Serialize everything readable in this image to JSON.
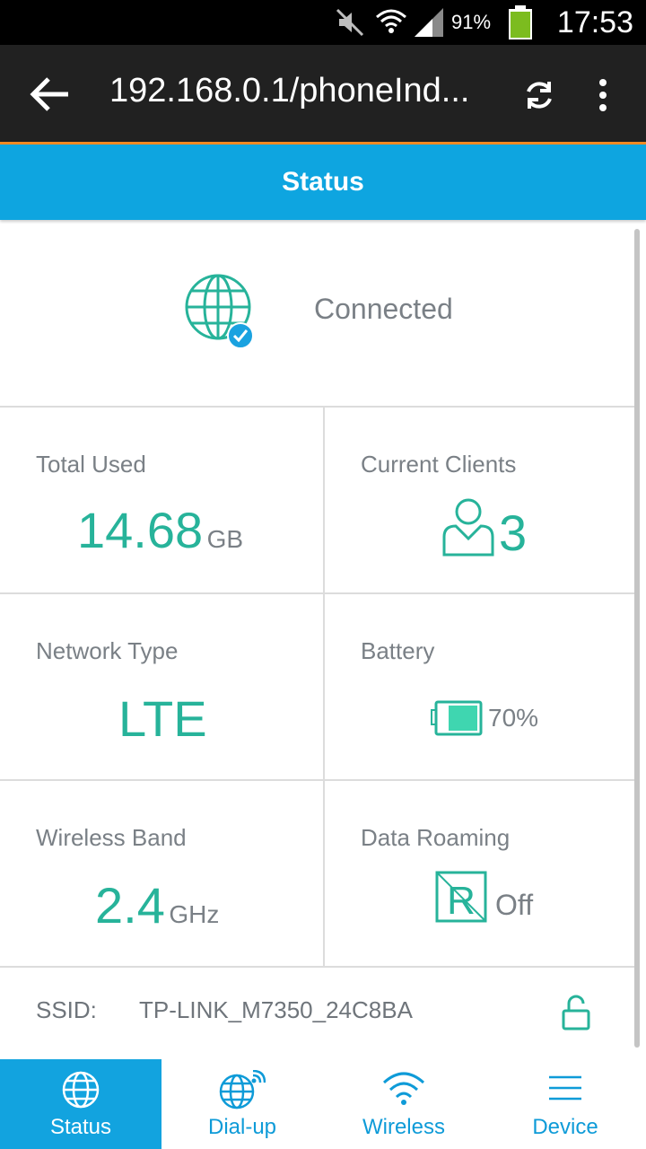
{
  "status_bar": {
    "battery_percent": "91%",
    "time": "17:53",
    "icons": [
      "mute-icon",
      "wifi-icon",
      "signal-icon",
      "battery-icon"
    ]
  },
  "browser": {
    "url": "192.168.0.1/phoneInd...",
    "icons": [
      "back-arrow-icon",
      "refresh-icon",
      "overflow-menu-icon"
    ]
  },
  "page": {
    "title": "Status"
  },
  "connection": {
    "status": "Connected",
    "icon": "globe-check-icon"
  },
  "grid": {
    "total_used": {
      "label": "Total Used",
      "value": "14.68",
      "unit": "GB"
    },
    "current_clients": {
      "label": "Current Clients",
      "value": "3",
      "icon": "user-icon"
    },
    "network_type": {
      "label": "Network Type",
      "value": "LTE"
    },
    "battery": {
      "label": "Battery",
      "value": "70%",
      "level": 0.7,
      "icon": "battery-icon"
    },
    "wireless_band": {
      "label": "Wireless Band",
      "value": "2.4",
      "unit": "GHz"
    },
    "data_roaming": {
      "label": "Data Roaming",
      "value": "Off",
      "icon": "roaming-icon"
    }
  },
  "ssid": {
    "label": "SSID:",
    "value": "TP-LINK_M7350_24C8BA",
    "icon": "unlock-icon"
  },
  "bottom_nav": [
    {
      "label": "Status",
      "icon": "globe-icon",
      "active": true
    },
    {
      "label": "Dial-up",
      "icon": "globe-signal-icon",
      "active": false
    },
    {
      "label": "Wireless",
      "icon": "wifi-icon",
      "active": false
    },
    {
      "label": "Device",
      "icon": "menu-icon",
      "active": false
    }
  ],
  "colors": {
    "accent": "#0ea5e0",
    "teal": "#27b39a",
    "browser_bar": "#212121",
    "orange_line": "#f08a24"
  }
}
